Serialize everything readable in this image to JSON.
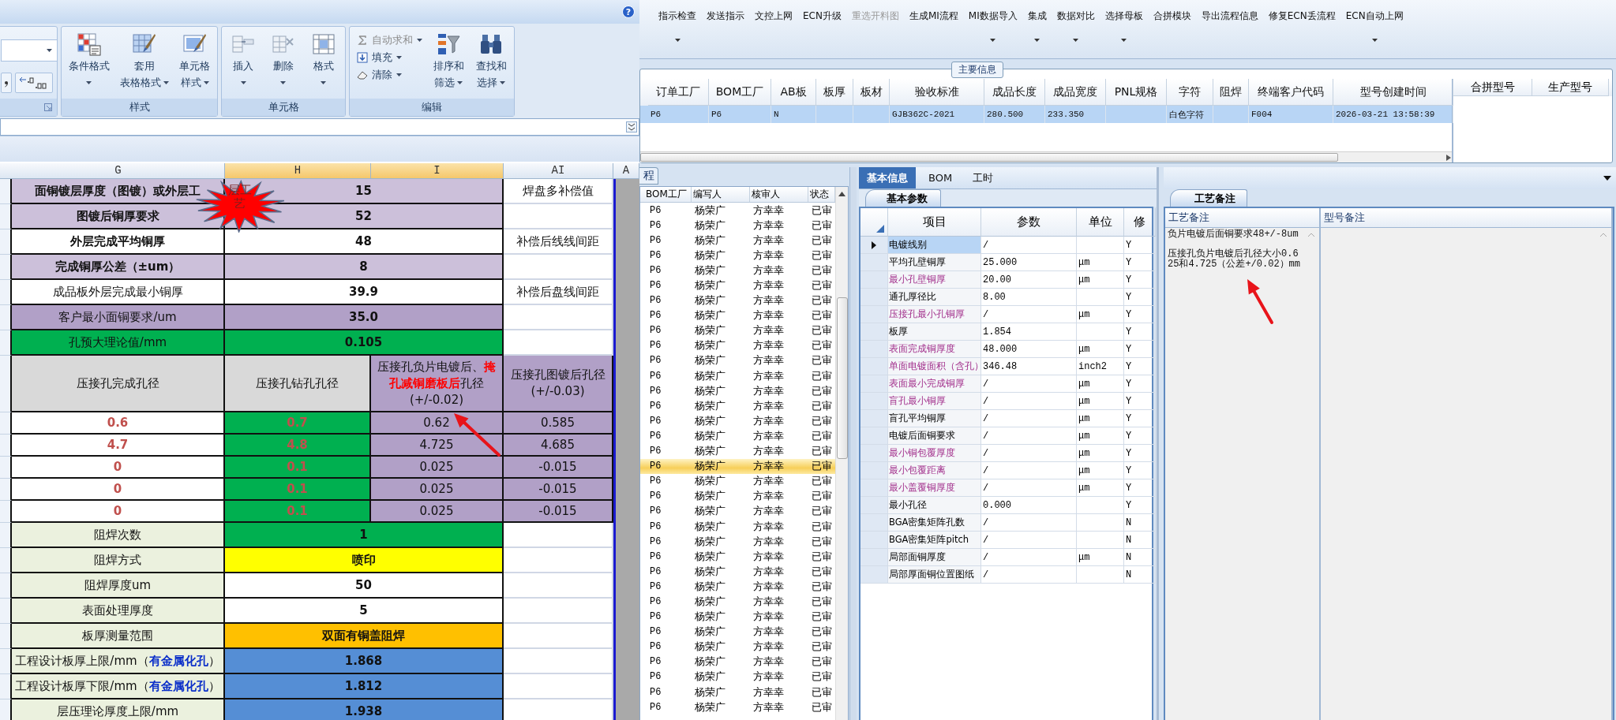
{
  "ribbon": {
    "help_icon": "?",
    "groups": [
      {
        "label": "样式",
        "buttons": [
          {
            "lines": [
              "条件格式"
            ],
            "dropdown": true
          },
          {
            "lines": [
              "套用",
              "表格格式"
            ],
            "dropdown": true
          },
          {
            "lines": [
              "单元格",
              "样式"
            ],
            "dropdown": true
          }
        ]
      },
      {
        "label": "单元格",
        "buttons": [
          {
            "lines": [
              "插入"
            ],
            "dropdown": true
          },
          {
            "lines": [
              "删除"
            ],
            "dropdown": true
          },
          {
            "lines": [
              "格式"
            ],
            "dropdown": true
          }
        ]
      },
      {
        "label": "编辑",
        "small_buttons": [
          {
            "label": "自动求和",
            "disabled": true,
            "dropdown": true
          },
          {
            "label": "填充",
            "disabled": false,
            "dropdown": true
          },
          {
            "label": "清除",
            "disabled": false,
            "dropdown": true
          }
        ],
        "buttons": [
          {
            "lines": [
              "排序和",
              "筛选"
            ],
            "dropdown": true
          },
          {
            "lines": [
              "查找和",
              "选择"
            ],
            "dropdown": true
          }
        ]
      }
    ]
  },
  "sheet": {
    "columns": [
      {
        "label": "G",
        "selected": false
      },
      {
        "label": "H",
        "selected": true
      },
      {
        "label": "I",
        "selected": true
      },
      {
        "label": "AI",
        "selected": false
      },
      {
        "label": "A",
        "selected": false
      }
    ],
    "sticker": "层工艺",
    "rows": [
      {
        "kind": "field",
        "cells": [
          {
            "text": "面铜镀层厚度（图镀）或外层工",
            "kind": "bold",
            "color": "#ccc0da"
          },
          {
            "text": "15",
            "kind": "bold",
            "color": "#ccc0da",
            "merged": true
          },
          {
            "text": "焊盘多补偿值",
            "kind": "plain",
            "color": "#ffffff"
          }
        ]
      },
      {
        "kind": "field",
        "cells": [
          {
            "text": "图镀后铜厚要求",
            "kind": "bold",
            "color": "#ccc0da"
          },
          {
            "text": "52",
            "kind": "bold",
            "color": "#ccc0da",
            "merged": true
          },
          {
            "color": "#ffffff"
          }
        ]
      },
      {
        "kind": "field",
        "cells": [
          {
            "text": "外层完成平均铜厚",
            "kind": "bold",
            "color": "#ffffff"
          },
          {
            "text": "48",
            "kind": "bold",
            "color": "#ffffff",
            "merged": true
          },
          {
            "text": "补偿后线线间距",
            "kind": "plain",
            "color": "#ffffff"
          }
        ]
      },
      {
        "kind": "field",
        "cells": [
          {
            "text": "完成铜厚公差（±um）",
            "kind": "bold",
            "color": "#ccc0da"
          },
          {
            "text": "8",
            "kind": "bold",
            "color": "#ccc0da",
            "merged": true
          },
          {
            "color": "#ffffff"
          }
        ]
      },
      {
        "kind": "field",
        "cells": [
          {
            "text": "成品板外层完成最小铜厚",
            "kind": "plain",
            "color": "#ffffff"
          },
          {
            "text": "39.9",
            "kind": "bold",
            "color": "#ffffff",
            "merged": true
          },
          {
            "text": "补偿后盘线间距",
            "kind": "plain",
            "color": "#ffffff"
          }
        ]
      },
      {
        "kind": "field",
        "cells": [
          {
            "text": "客户最小面铜要求/um",
            "kind": "plain",
            "color": "#b1a0c7"
          },
          {
            "text": "35.0",
            "kind": "bold",
            "color": "#b1a0c7",
            "merged": true
          },
          {
            "color": "#ffffff"
          }
        ]
      },
      {
        "kind": "field",
        "cells": [
          {
            "text": "孔预大理论值/mm",
            "kind": "plain",
            "color": "#00b050"
          },
          {
            "text": "0.105",
            "kind": "bold",
            "color": "#00b050",
            "merged": true
          },
          {
            "color": "#ffffff"
          }
        ]
      },
      {
        "kind": "header",
        "cells": [
          {
            "text": "压接孔完成孔径",
            "kind": "plain",
            "color": "#d9d9d9"
          },
          {
            "text": "压接孔钻孔孔径",
            "kind": "plain",
            "color": "#d9d9d9"
          },
          {
            "text": "压接孔负片电镀后、**掩孔减铜磨板后**孔径(+/-0.02)",
            "kind": "rich-red",
            "color": "#b1a0c7"
          },
          {
            "text": "压接孔图镀后孔径(+/-0.03)",
            "kind": "plain",
            "color": "#b1a0c7"
          }
        ]
      },
      {
        "kind": "value",
        "cells": [
          {
            "text": "0.6",
            "kind": "red",
            "color": "#ffffff"
          },
          {
            "text": "0.7",
            "kind": "red",
            "color": "#00b050"
          },
          {
            "text": "0.62",
            "kind": "plain",
            "color": "#b1a0c7"
          },
          {
            "text": "0.585",
            "kind": "plain",
            "color": "#b1a0c7"
          }
        ]
      },
      {
        "kind": "value",
        "cells": [
          {
            "text": "4.7",
            "kind": "red",
            "color": "#ffffff"
          },
          {
            "text": "4.8",
            "kind": "red",
            "color": "#00b050"
          },
          {
            "text": "4.725",
            "kind": "plain",
            "color": "#b1a0c7"
          },
          {
            "text": "4.685",
            "kind": "plain",
            "color": "#b1a0c7"
          }
        ]
      },
      {
        "kind": "value",
        "cells": [
          {
            "text": "0",
            "kind": "red",
            "color": "#ffffff"
          },
          {
            "text": "0.1",
            "kind": "red",
            "color": "#00b050"
          },
          {
            "text": "0.025",
            "kind": "plain",
            "color": "#b1a0c7"
          },
          {
            "text": "-0.015",
            "kind": "plain",
            "color": "#b1a0c7"
          }
        ]
      },
      {
        "kind": "value",
        "cells": [
          {
            "text": "0",
            "kind": "red",
            "color": "#ffffff"
          },
          {
            "text": "0.1",
            "kind": "red",
            "color": "#00b050"
          },
          {
            "text": "0.025",
            "kind": "plain",
            "color": "#b1a0c7"
          },
          {
            "text": "-0.015",
            "kind": "plain",
            "color": "#b1a0c7"
          }
        ]
      },
      {
        "kind": "value",
        "cells": [
          {
            "text": "0",
            "kind": "red",
            "color": "#ffffff"
          },
          {
            "text": "0.1",
            "kind": "red",
            "color": "#00b050"
          },
          {
            "text": "0.025",
            "kind": "plain",
            "color": "#b1a0c7"
          },
          {
            "text": "-0.015",
            "kind": "plain",
            "color": "#b1a0c7"
          }
        ]
      },
      {
        "kind": "field",
        "cells": [
          {
            "text": "阻焊次数",
            "kind": "plain",
            "color": "#ebf1de"
          },
          {
            "text": "1",
            "kind": "bold",
            "color": "#00b050",
            "merged": true
          },
          {
            "color": "#ffffff"
          }
        ]
      },
      {
        "kind": "field",
        "cells": [
          {
            "text": "阻焊方式",
            "kind": "plain",
            "color": "#ebf1de"
          },
          {
            "text": "喷印",
            "kind": "bold",
            "color": "#ffff00",
            "merged": true
          },
          {
            "color": "#ffffff"
          }
        ]
      },
      {
        "kind": "field",
        "cells": [
          {
            "text": "阻焊厚度um",
            "kind": "plain",
            "color": "#ebf1de"
          },
          {
            "text": "50",
            "kind": "bold",
            "color": "#ffffff",
            "merged": true
          },
          {
            "color": "#ffffff"
          }
        ]
      },
      {
        "kind": "field",
        "cells": [
          {
            "text": "表面处理厚度",
            "kind": "plain",
            "color": "#ebf1de"
          },
          {
            "text": "5",
            "kind": "bold",
            "color": "#ffffff",
            "merged": true
          },
          {
            "color": "#ffffff"
          }
        ]
      },
      {
        "kind": "field",
        "cells": [
          {
            "text": "板厚测量范围",
            "kind": "plain",
            "color": "#ebf1de"
          },
          {
            "text": "双面有铜盖阻焊",
            "kind": "bold",
            "color": "#ffc000",
            "merged": true
          },
          {
            "color": "#ffffff"
          }
        ]
      },
      {
        "kind": "field",
        "cells": [
          {
            "text": "工程设计板厚上限/mm（**有金属化孔**）",
            "kind": "rich-blue",
            "color": "#ebf1de"
          },
          {
            "text": "1.868",
            "kind": "bold",
            "color": "#558ed5",
            "merged": true
          },
          {
            "color": "#ffffff"
          }
        ]
      },
      {
        "kind": "field",
        "cells": [
          {
            "text": "工程设计板厚下限/mm（**有金属化孔**）",
            "kind": "rich-blue",
            "color": "#ebf1de"
          },
          {
            "text": "1.812",
            "kind": "bold",
            "color": "#558ed5",
            "merged": true
          },
          {
            "color": "#ffffff"
          }
        ]
      },
      {
        "kind": "field",
        "cells": [
          {
            "text": "层压理论厚度上限/mm",
            "kind": "plain",
            "color": "#ebf1de"
          },
          {
            "text": "1.938",
            "kind": "bold",
            "color": "#558ed5",
            "merged": true
          },
          {
            "color": "#ffffff"
          }
        ]
      }
    ]
  },
  "toolbar": {
    "items": [
      {
        "label": "指示检查",
        "disabled": false,
        "dropdown": true
      },
      {
        "label": "发送指示",
        "disabled": false,
        "dropdown": false
      },
      {
        "label": "文控上网",
        "disabled": false,
        "dropdown": false
      },
      {
        "label": "ECN升级",
        "disabled": false,
        "dropdown": false
      },
      {
        "label": "重选开料图",
        "disabled": true,
        "dropdown": false
      },
      {
        "label": "生成MI流程",
        "disabled": false,
        "dropdown": false
      },
      {
        "label": "MI数据导入",
        "disabled": false,
        "dropdown": true
      },
      {
        "label": "集成",
        "disabled": false,
        "dropdown": true
      },
      {
        "label": "数据对比",
        "disabled": false,
        "dropdown": true
      },
      {
        "label": "选择母板",
        "disabled": false,
        "dropdown": true
      },
      {
        "label": "合拼模块",
        "disabled": false,
        "dropdown": false
      },
      {
        "label": "导出流程信息",
        "disabled": false,
        "dropdown": false
      },
      {
        "label": "修复ECN丢流程",
        "disabled": false,
        "dropdown": false
      },
      {
        "label": "ECN自动上网",
        "disabled": false,
        "dropdown": true
      }
    ]
  },
  "main_info": {
    "title": "主要信息",
    "columns": [
      "订单工厂",
      "BOM工厂",
      "AB板",
      "板厚",
      "板材",
      "验收标准",
      "成品长度",
      "成品宽度",
      "PNL规格",
      "字符",
      "阻焊",
      "终端客户代码",
      "型号创建时间"
    ],
    "rows": [
      {
        "selected": true,
        "cells": [
          "P6",
          "P6",
          "N",
          null,
          null,
          "GJB362C-2021",
          "280.500",
          "233.350",
          null,
          "白色字符",
          null,
          "F004",
          "2026-03-21 13:58:39"
        ]
      }
    ],
    "side_columns": [
      "合拼型号",
      "生产型号"
    ]
  },
  "list": {
    "tab": "程",
    "columns": [
      "BOM工厂",
      "编写人",
      "核审人",
      "状态"
    ],
    "rows": [
      {
        "selected": false,
        "cells": [
          "P6",
          "杨荣广",
          "方幸幸",
          "已审"
        ]
      },
      {
        "selected": false,
        "cells": [
          "P6",
          "杨荣广",
          "方幸幸",
          "已审"
        ]
      },
      {
        "selected": false,
        "cells": [
          "P6",
          "杨荣广",
          "方幸幸",
          "已审"
        ]
      },
      {
        "selected": false,
        "cells": [
          "P6",
          "杨荣广",
          "方幸幸",
          "已审"
        ]
      },
      {
        "selected": false,
        "cells": [
          "P6",
          "杨荣广",
          "方幸幸",
          "已审"
        ]
      },
      {
        "selected": false,
        "cells": [
          "P6",
          "杨荣广",
          "方幸幸",
          "已审"
        ]
      },
      {
        "selected": false,
        "cells": [
          "P6",
          "杨荣广",
          "方幸幸",
          "已审"
        ]
      },
      {
        "selected": false,
        "cells": [
          "P6",
          "杨荣广",
          "方幸幸",
          "已审"
        ]
      },
      {
        "selected": false,
        "cells": [
          "P6",
          "杨荣广",
          "方幸幸",
          "已审"
        ]
      },
      {
        "selected": false,
        "cells": [
          "P6",
          "杨荣广",
          "方幸幸",
          "已审"
        ]
      },
      {
        "selected": false,
        "cells": [
          "P6",
          "杨荣广",
          "方幸幸",
          "已审"
        ]
      },
      {
        "selected": false,
        "cells": [
          "P6",
          "杨荣广",
          "方幸幸",
          "已审"
        ]
      },
      {
        "selected": false,
        "cells": [
          "P6",
          "杨荣广",
          "方幸幸",
          "已审"
        ]
      },
      {
        "selected": false,
        "cells": [
          "P6",
          "杨荣广",
          "方幸幸",
          "已审"
        ]
      },
      {
        "selected": false,
        "cells": [
          "P6",
          "杨荣广",
          "方幸幸",
          "已审"
        ]
      },
      {
        "selected": false,
        "cells": [
          "P6",
          "杨荣广",
          "方幸幸",
          "已审"
        ]
      },
      {
        "selected": false,
        "cells": [
          "P6",
          "杨荣广",
          "方幸幸",
          "已审"
        ]
      },
      {
        "selected": true,
        "cells": [
          "P6",
          "杨荣广",
          "方幸幸",
          "已审"
        ]
      },
      {
        "selected": false,
        "cells": [
          "P6",
          "杨荣广",
          "方幸幸",
          "已审"
        ]
      },
      {
        "selected": false,
        "cells": [
          "P6",
          "杨荣广",
          "方幸幸",
          "已审"
        ]
      },
      {
        "selected": false,
        "cells": [
          "P6",
          "杨荣广",
          "方幸幸",
          "已审"
        ]
      },
      {
        "selected": false,
        "cells": [
          "P6",
          "杨荣广",
          "方幸幸",
          "已审"
        ]
      },
      {
        "selected": false,
        "cells": [
          "P6",
          "杨荣广",
          "方幸幸",
          "已审"
        ]
      },
      {
        "selected": false,
        "cells": [
          "P6",
          "杨荣广",
          "方幸幸",
          "已审"
        ]
      },
      {
        "selected": false,
        "cells": [
          "P6",
          "杨荣广",
          "方幸幸",
          "已审"
        ]
      },
      {
        "selected": false,
        "cells": [
          "P6",
          "杨荣广",
          "方幸幸",
          "已审"
        ]
      },
      {
        "selected": false,
        "cells": [
          "P6",
          "杨荣广",
          "方幸幸",
          "已审"
        ]
      },
      {
        "selected": false,
        "cells": [
          "P6",
          "杨荣广",
          "方幸幸",
          "已审"
        ]
      },
      {
        "selected": false,
        "cells": [
          "P6",
          "杨荣广",
          "方幸幸",
          "已审"
        ]
      },
      {
        "selected": false,
        "cells": [
          "P6",
          "杨荣广",
          "方幸幸",
          "已审"
        ]
      },
      {
        "selected": false,
        "cells": [
          "P6",
          "杨荣广",
          "方幸幸",
          "已审"
        ]
      },
      {
        "selected": false,
        "cells": [
          "P6",
          "杨荣广",
          "方幸幸",
          "已审"
        ]
      },
      {
        "selected": false,
        "cells": [
          "P6",
          "杨荣广",
          "方幸幸",
          "已审"
        ]
      },
      {
        "selected": false,
        "cells": [
          "P6",
          "杨荣广",
          "方幸幸",
          "已审"
        ]
      }
    ]
  },
  "params": {
    "tabs": [
      {
        "label": "基本信息",
        "selected": true
      },
      {
        "label": "BOM",
        "selected": false
      },
      {
        "label": "工时",
        "selected": false
      }
    ],
    "subtab": "基本参数",
    "columns": [
      "项目",
      "参数",
      "单位",
      "修"
    ],
    "rows": [
      {
        "item": "电镀线别",
        "value": "/",
        "modified": "Y",
        "highlighted": false,
        "selected": true
      },
      {
        "item": "平均孔壁铜厚",
        "value": "25.000",
        "unit": "μm",
        "modified": "Y",
        "highlighted": false,
        "selected": false
      },
      {
        "item": "最小孔壁铜厚",
        "value": "20.00",
        "unit": "μm",
        "modified": "Y",
        "highlighted": true,
        "selected": false
      },
      {
        "item": "通孔厚径比",
        "value": "8.00",
        "modified": "Y",
        "highlighted": false,
        "selected": false
      },
      {
        "item": "压接孔最小孔铜厚",
        "value": "/",
        "unit": "μm",
        "modified": "Y",
        "highlighted": true,
        "selected": false
      },
      {
        "item": "板厚",
        "value": "1.854",
        "modified": "Y",
        "highlighted": false,
        "selected": false
      },
      {
        "item": "表面完成铜厚度",
        "value": "48.000",
        "unit": "μm",
        "modified": "Y",
        "highlighted": true,
        "selected": false
      },
      {
        "item": "单面电镀面积（含孔）",
        "value": "346.48",
        "unit": "inch2",
        "modified": "Y",
        "highlighted": true,
        "selected": false
      },
      {
        "item": "表面最小完成铜厚",
        "value": "/",
        "unit": "μm",
        "modified": "Y",
        "highlighted": true,
        "selected": false
      },
      {
        "item": "盲孔最小铜厚",
        "value": "/",
        "unit": "μm",
        "modified": "Y",
        "highlighted": true,
        "selected": false
      },
      {
        "item": "盲孔平均铜厚",
        "value": "/",
        "unit": "μm",
        "modified": "Y",
        "highlighted": false,
        "selected": false
      },
      {
        "item": "电镀后面铜要求",
        "value": "/",
        "unit": "μm",
        "modified": "Y",
        "highlighted": false,
        "selected": false
      },
      {
        "item": "最小铜包覆厚度",
        "value": "/",
        "unit": "μm",
        "modified": "Y",
        "highlighted": true,
        "selected": false
      },
      {
        "item": "最小包覆距离",
        "value": "/",
        "unit": "μm",
        "modified": "Y",
        "highlighted": true,
        "selected": false
      },
      {
        "item": "最小盖覆铜厚度",
        "value": "/",
        "unit": "μm",
        "modified": "Y",
        "highlighted": true,
        "selected": false
      },
      {
        "item": "最小孔径",
        "value": "0.000",
        "modified": "Y",
        "highlighted": false,
        "selected": false
      },
      {
        "item": "BGA密集矩阵孔数",
        "value": "/",
        "modified": "N",
        "highlighted": false,
        "selected": false
      },
      {
        "item": "BGA密集矩阵pitch",
        "value": "/",
        "modified": "N",
        "highlighted": false,
        "selected": false
      },
      {
        "item": "局部面铜厚度",
        "value": "/",
        "unit": "μm",
        "modified": "N",
        "highlighted": false,
        "selected": false
      },
      {
        "item": "局部厚面铜位置图纸",
        "value": "/",
        "modified": "N",
        "highlighted": false,
        "selected": false
      }
    ]
  },
  "notes": {
    "tab": "工艺备注",
    "columns": [
      "工艺备注",
      "型号备注"
    ],
    "lines": [
      "负片电镀后面铜要求48+/-8um",
      "压接孔负片电镀后孔径大小0.625和4.725（公差+/0.02）mm"
    ]
  }
}
